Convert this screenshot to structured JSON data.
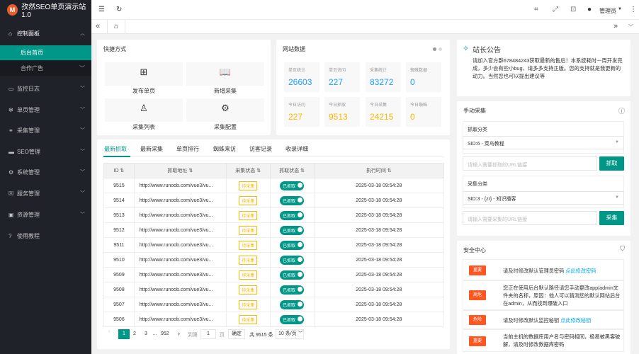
{
  "app": {
    "title": "孜然SEO单页演示站1.0"
  },
  "sidebar": {
    "items": [
      {
        "label": "控制面板",
        "icon": "home-icon"
      },
      {
        "label": "监控日志",
        "icon": "monitor-icon"
      },
      {
        "label": "单页管理",
        "icon": "asterisk-icon"
      },
      {
        "label": "采集管理",
        "icon": "link-icon"
      },
      {
        "label": "SEO管理",
        "icon": "chat-icon"
      },
      {
        "label": "系统管理",
        "icon": "gear-icon"
      },
      {
        "label": "服务管理",
        "icon": "service-icon"
      },
      {
        "label": "资源管理",
        "icon": "image-icon"
      },
      {
        "label": "使用教程",
        "icon": "help-icon"
      }
    ],
    "sub_items": [
      {
        "label": "后台首页"
      },
      {
        "label": "合作广告"
      }
    ]
  },
  "header": {
    "user": "管理员"
  },
  "shortcuts": {
    "title": "快捷方式",
    "items": [
      {
        "label": "发布单页",
        "icon": "grid-icon"
      },
      {
        "label": "新增采集",
        "icon": "book-icon"
      },
      {
        "label": "采集列表",
        "icon": "user-icon"
      },
      {
        "label": "采集配置",
        "icon": "gear-icon"
      }
    ]
  },
  "site_data": {
    "title": "网站数据",
    "stats": [
      {
        "label": "单页统计",
        "value": "26603"
      },
      {
        "label": "单页访问",
        "value": "227"
      },
      {
        "label": "采集统计",
        "value": "83272"
      },
      {
        "label": "蜘蛛数据",
        "value": "0"
      },
      {
        "label": "今日访问",
        "value": "227"
      },
      {
        "label": "今日抓取",
        "value": "9513"
      },
      {
        "label": "今日采集",
        "value": "24215"
      },
      {
        "label": "今日蜘蛛",
        "value": "0"
      }
    ],
    "colors": {
      "top": "#1e9fff",
      "bottom": "#ffb800"
    }
  },
  "notice": {
    "title": "站长公告",
    "text": "请加入官方群678484243获取最新的售后！本系统耗时一周开发完成，多少会有些小bug，请多多支持正版。您的支持就是我更新的动力。当然您也可以提出建议等"
  },
  "manual": {
    "title": "手动采集",
    "crawl_group_label": "抓取分类",
    "crawl_select": "SID:6 - 菜鸟教程",
    "crawl_placeholder": "请输入需要抓取的URL链接",
    "crawl_button": "抓取",
    "collect_group_label": "采集分类",
    "collect_select": "SID:3 - {zr} - 知识播客",
    "collect_placeholder": "请输入需要采集的URL链接",
    "collect_button": "采集"
  },
  "security": {
    "title": "安全中心",
    "items": [
      {
        "tag": "重要",
        "color": "#ff5722",
        "text": "请及时修改默认管理员密码 ",
        "link": "点此修改密码"
      },
      {
        "tag": "高危",
        "color": "#ff5722",
        "text": "您正在使用后台默认路径请您手动更改app/admin文件夹的名称，原因：他人可以猜测您的默认网站后台在admin，从而找到爆破入口",
        "link": ""
      },
      {
        "tag": "危险",
        "color": "#ff5722",
        "text": "请及时修改默认监控秘钥 ",
        "link": "点此修改秘钥"
      },
      {
        "tag": "重要",
        "color": "#ff5722",
        "text": "当前主机的数据库用户名与密码相同，极易被黑客破解，请及时修改数据库密码",
        "link": ""
      }
    ]
  },
  "crawl_tabs": [
    "最新抓取",
    "最新采集",
    "单页排行",
    "蜘蛛来访",
    "访客记录",
    "收录详细"
  ],
  "table": {
    "headers": [
      "ID",
      "抓取地址",
      "采集状态",
      "抓取状态",
      "执行时间"
    ],
    "rows": [
      {
        "id": "9515",
        "url": "http://www.runoob.com/vue3/vu...",
        "collect": "待采集",
        "crawl": "已抓取",
        "time": "2025-03-18 09:54:28"
      },
      {
        "id": "9514",
        "url": "http://www.runoob.com/vue3/vu...",
        "collect": "待采集",
        "crawl": "已抓取",
        "time": "2025-03-18 09:54:28"
      },
      {
        "id": "9513",
        "url": "http://www.runoob.com/vue3/vu...",
        "collect": "待采集",
        "crawl": "已抓取",
        "time": "2025-03-18 09:54:28"
      },
      {
        "id": "9512",
        "url": "http://www.runoob.com/vue3/vu...",
        "collect": "待采集",
        "crawl": "已抓取",
        "time": "2025-03-18 09:54:28"
      },
      {
        "id": "9511",
        "url": "http://www.runoob.com/vue3/vu...",
        "collect": "待采集",
        "crawl": "已抓取",
        "time": "2025-03-18 09:54:28"
      },
      {
        "id": "9510",
        "url": "http://www.runoob.com/vue3/vu...",
        "collect": "待采集",
        "crawl": "已抓取",
        "time": "2025-03-18 09:54:28"
      },
      {
        "id": "9509",
        "url": "http://www.runoob.com/vue3/vu...",
        "collect": "待采集",
        "crawl": "已抓取",
        "time": "2025-03-18 09:54:28"
      },
      {
        "id": "9508",
        "url": "http://www.runoob.com/vue3/vu...",
        "collect": "待采集",
        "crawl": "已抓取",
        "time": "2025-03-18 09:54:28"
      },
      {
        "id": "9507",
        "url": "http://www.runoob.com/vue3/vu...",
        "collect": "待采集",
        "crawl": "已抓取",
        "time": "2025-03-18 09:54:28"
      },
      {
        "id": "9506",
        "url": "http://www.runoob.com/vue3/vu...",
        "collect": "待采集",
        "crawl": "已抓取",
        "time": "2025-03-18 09:54:28"
      }
    ]
  },
  "pager": {
    "pages": [
      "1",
      "2",
      "3",
      "…",
      "952"
    ],
    "goto_label": "到第",
    "page_input": "1",
    "page_unit": "页",
    "confirm": "确定",
    "total": "共 9515 条",
    "per_page": "10 条/页"
  },
  "colors": {
    "accent": "#009688",
    "sidebar_bg": "#20222a",
    "pending": "#ffb800",
    "danger": "#ff5722"
  }
}
